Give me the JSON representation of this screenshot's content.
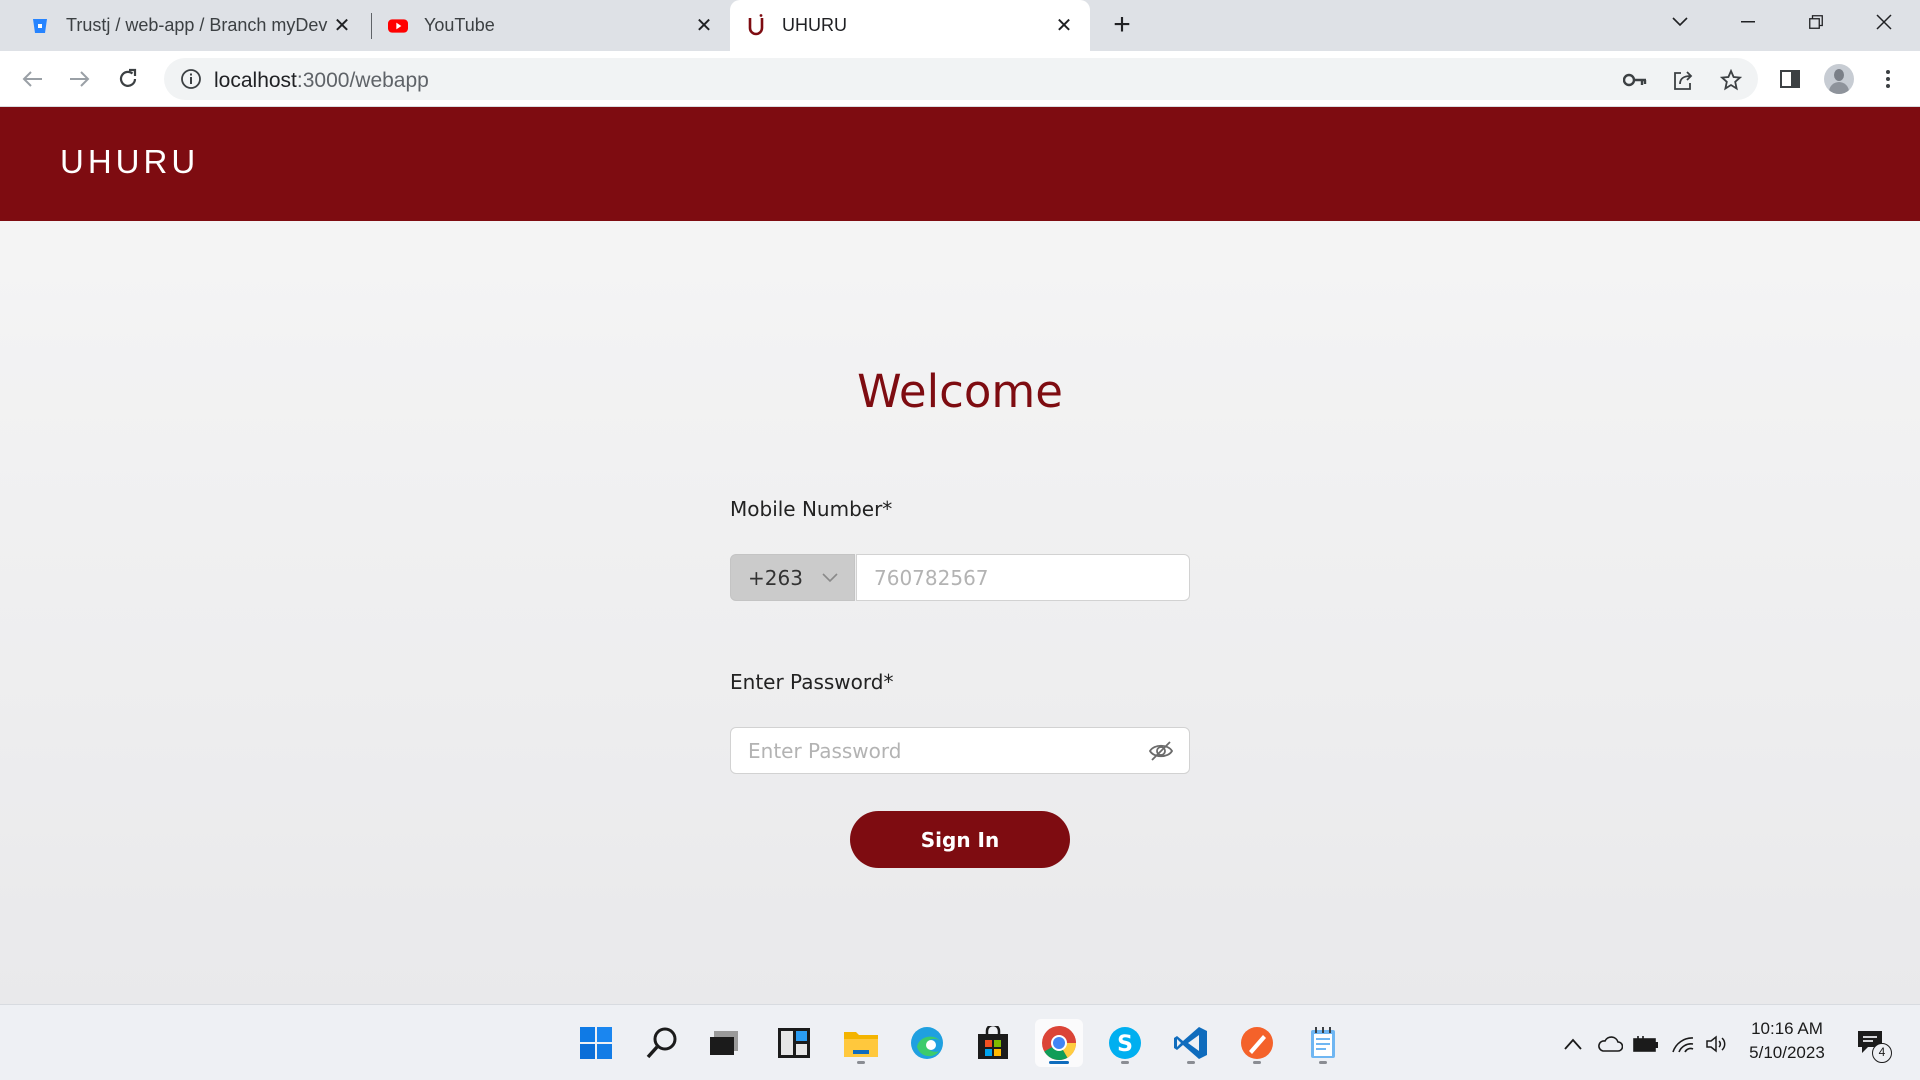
{
  "browser": {
    "tabs": [
      {
        "title": "Trustj / web-app / Branch myDev",
        "favicon": "bitbucket-icon",
        "active": false
      },
      {
        "title": "YouTube",
        "favicon": "youtube-icon",
        "active": false
      },
      {
        "title": "UHURU",
        "favicon": "uhuru-icon",
        "active": true
      }
    ],
    "address": {
      "host": "localhost",
      "path": ":3000/webapp"
    }
  },
  "app": {
    "logo": "UHURU",
    "welcome": "Welcome",
    "mobile_label": "Mobile Number*",
    "country_code": "+263",
    "phone_placeholder": "760782567",
    "password_label": "Enter Password*",
    "password_placeholder": "Enter Password",
    "signin_label": "Sign In"
  },
  "taskbar": {
    "apps": [
      "start-icon",
      "search-icon",
      "task-view-icon",
      "widgets-icon",
      "file-explorer-icon",
      "edge-icon",
      "store-icon",
      "chrome-icon",
      "skype-icon",
      "vscode-icon",
      "paint-icon",
      "notepad-icon"
    ],
    "time": "10:16 AM",
    "date": "5/10/2023",
    "notification_count": "4"
  },
  "colors": {
    "brand": "#7e0c11",
    "tabstrip": "#dee1e6",
    "page_bg": "#f4f4f4"
  }
}
